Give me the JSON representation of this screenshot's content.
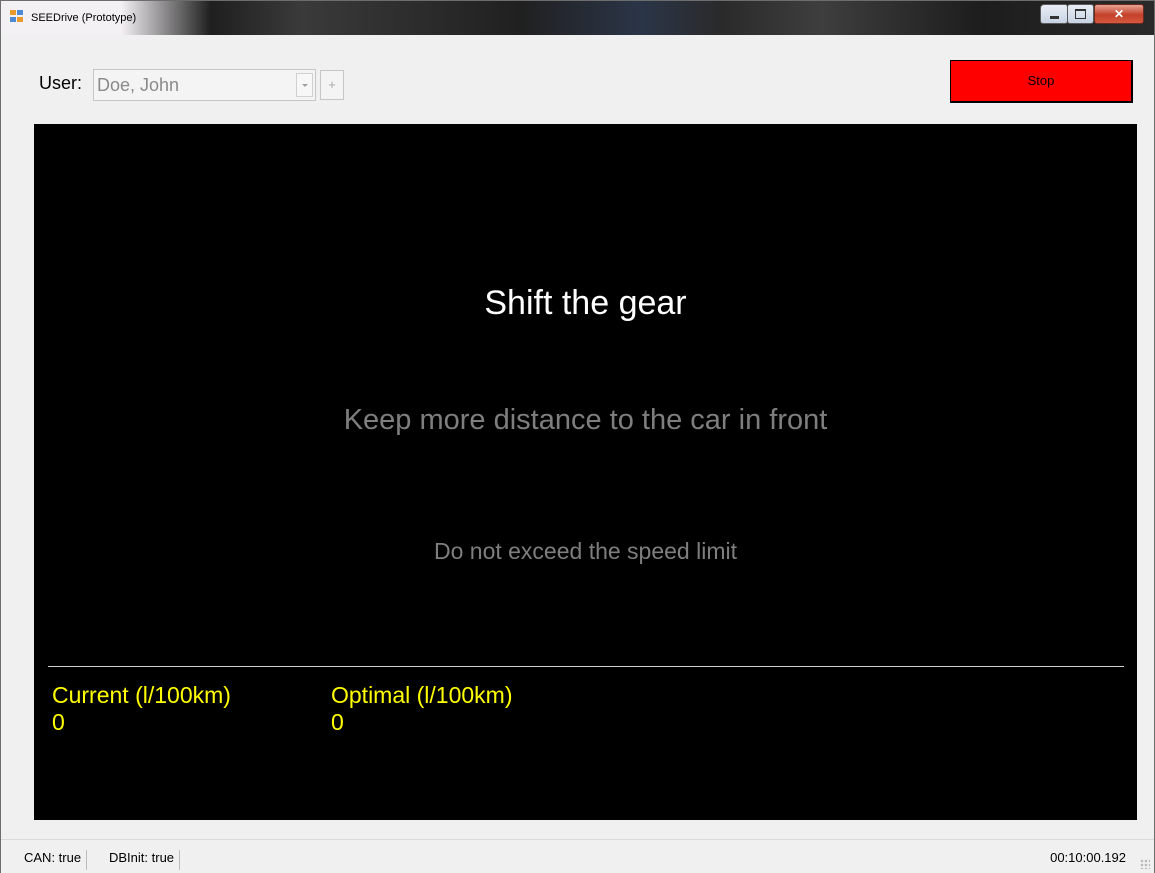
{
  "window": {
    "title": "SEEDrive (Prototype)",
    "controls": [
      "minimize-icon",
      "maximize-icon",
      "close-icon"
    ]
  },
  "toolbar": {
    "user_label": "User:",
    "user_value": "Doe, John",
    "add_label": "+",
    "stop_label": "Stop",
    "stop_color": "#ff0000"
  },
  "display": {
    "background": "#000000",
    "messages": [
      "Shift the gear",
      "Keep more distance to the car in front",
      "Do not exceed the speed limit"
    ],
    "current_label": "Current (l/100km)",
    "current_value": "0",
    "optimal_label": "Optimal (l/100km)",
    "optimal_value": "0",
    "stat_color": "#ffff00"
  },
  "statusbar": {
    "can": "CAN: true",
    "dbinit": "DBInit: true",
    "time": "00:10:00.192"
  }
}
